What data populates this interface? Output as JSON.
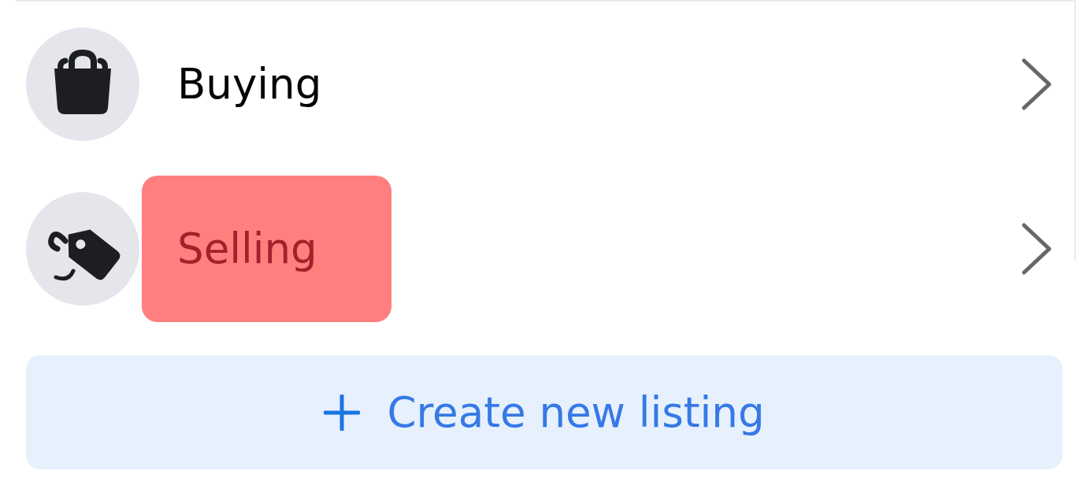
{
  "menu_items": [
    {
      "kind": "buying",
      "label": "Buying",
      "highlighted": false
    },
    {
      "kind": "selling",
      "label": "Selling",
      "highlighted": true
    }
  ],
  "create_button": {
    "label": "Create new listing"
  }
}
